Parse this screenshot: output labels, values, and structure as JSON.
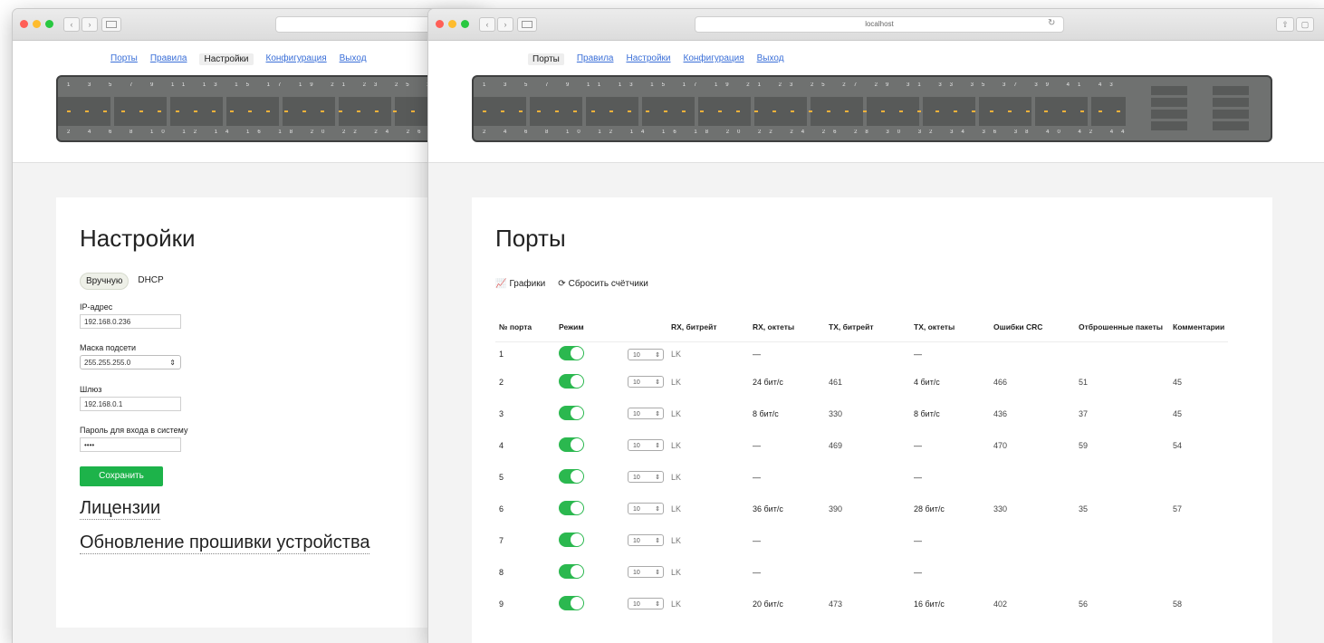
{
  "back_window": {
    "nav": [
      "Порты",
      "Правила",
      "Настройки",
      "Конфигурация",
      "Выход"
    ],
    "active_nav": "Настройки",
    "page_title": "Настройки",
    "mode_manual": "Вручную",
    "mode_dhcp": "DHCP",
    "ip_label": "IP-адрес",
    "ip_value": "192.168.0.236",
    "mask_label": "Маска подсети",
    "mask_value": "255.255.255.0",
    "gateway_label": "Шлюз",
    "gateway_value": "192.168.0.1",
    "password_label": "Пароль для входа в систему",
    "password_value": "••••",
    "save_label": "Сохранить",
    "licenses_label": "Лицензии",
    "firmware_label": "Обновление прошивки устройства"
  },
  "front_window": {
    "url": "localhost",
    "nav": [
      "Порты",
      "Правила",
      "Настройки",
      "Конфигурация",
      "Выход"
    ],
    "active_nav": "Порты",
    "page_title": "Порты",
    "charts_label": "Графики",
    "reset_label": "Сбросить счётчики",
    "table": {
      "headers": [
        "№ порта",
        "Режим",
        "",
        "RX, битрейт",
        "RX, октеты",
        "TX, битрейт",
        "TX, октеты",
        "Ошибки CRC",
        "Отброшенные пакеты",
        "Комментарии"
      ],
      "rows": [
        {
          "port": "1",
          "mode": "10",
          "x": "LK",
          "rx_bit": "—",
          "rx_oct": "",
          "tx_bit": "—",
          "tx_oct": "",
          "crc": "",
          "drop": ""
        },
        {
          "port": "2",
          "mode": "10",
          "x": "LK",
          "rx_bit": "24 бит/с",
          "rx_oct": "461",
          "tx_bit": "4 бит/с",
          "tx_oct": "466",
          "crc": "51",
          "drop": "45"
        },
        {
          "port": "3",
          "mode": "10",
          "x": "LK",
          "rx_bit": "8 бит/с",
          "rx_oct": "330",
          "tx_bit": "8 бит/с",
          "tx_oct": "436",
          "crc": "37",
          "drop": "45"
        },
        {
          "port": "4",
          "mode": "10",
          "x": "LK",
          "rx_bit": "—",
          "rx_oct": "469",
          "tx_bit": "—",
          "tx_oct": "470",
          "crc": "59",
          "drop": "54"
        },
        {
          "port": "5",
          "mode": "10",
          "x": "LK",
          "rx_bit": "—",
          "rx_oct": "",
          "tx_bit": "—",
          "tx_oct": "",
          "crc": "",
          "drop": ""
        },
        {
          "port": "6",
          "mode": "10",
          "x": "LK",
          "rx_bit": "36 бит/с",
          "rx_oct": "390",
          "tx_bit": "28 бит/с",
          "tx_oct": "330",
          "crc": "35",
          "drop": "57"
        },
        {
          "port": "7",
          "mode": "10",
          "x": "LK",
          "rx_bit": "—",
          "rx_oct": "",
          "tx_bit": "—",
          "tx_oct": "",
          "crc": "",
          "drop": ""
        },
        {
          "port": "8",
          "mode": "10",
          "x": "LK",
          "rx_bit": "—",
          "rx_oct": "",
          "tx_bit": "—",
          "tx_oct": "",
          "crc": "",
          "drop": ""
        },
        {
          "port": "9",
          "mode": "10",
          "x": "LK",
          "rx_bit": "20 бит/с",
          "rx_oct": "473",
          "tx_bit": "16 бит/с",
          "tx_oct": "402",
          "crc": "56",
          "drop": "58"
        }
      ]
    }
  },
  "switch_top_numbers": "1 3 5 7 9 11 13 15 17 19 21 23 25 27 29 31 33 35 37 39 41 43 45 47",
  "switch_bottom_numbers": "2 4 6 8 10 12 14 16 18 20 22 24 26 28 30 32 34 36 38 40 42 44 46 48",
  "colors": {
    "accent_green": "#1db34a",
    "link_blue": "#3a6fd8"
  }
}
